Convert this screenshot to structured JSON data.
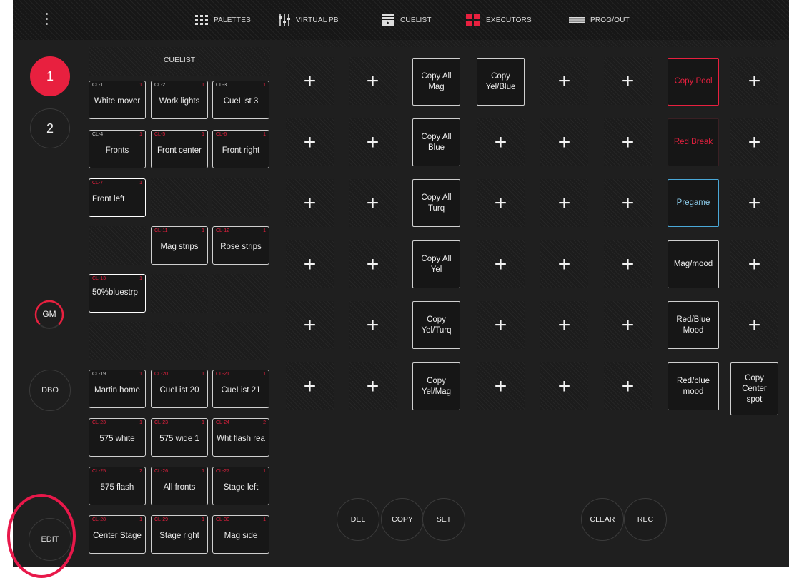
{
  "topbar": {
    "nav": [
      {
        "label": "PALETTES",
        "icon": "grid-icon"
      },
      {
        "label": "VIRTUAL PB",
        "icon": "faders-icon"
      },
      {
        "label": "CUELIST",
        "icon": "cuelist-icon"
      },
      {
        "label": "EXECUTORS",
        "icon": "executors-icon"
      },
      {
        "label": "PROG/OUT",
        "icon": "progout-icon"
      }
    ]
  },
  "left": {
    "page1": "1",
    "page2": "2",
    "gm": "GM",
    "dbo": "DBO",
    "edit": "EDIT"
  },
  "cuelist": {
    "header": "CUELIST",
    "items": [
      {
        "id": "CL-1",
        "num": "1",
        "label": "White mover"
      },
      {
        "id": "CL-2",
        "num": "1",
        "label": "Work lights"
      },
      {
        "id": "CL-3",
        "num": "1",
        "label": "CueList 3"
      },
      {
        "id": "CL-4",
        "num": "1",
        "label": "Fronts"
      },
      {
        "id": "CL-5",
        "num": "1",
        "label": "Front center"
      },
      {
        "id": "CL-6",
        "num": "1",
        "label": "Front right"
      },
      {
        "id": "CL-7",
        "num": "1",
        "label": "Front left"
      },
      {
        "id": "CL-11",
        "num": "1",
        "label": "Mag strips"
      },
      {
        "id": "CL-12",
        "num": "1",
        "label": "Rose strips"
      },
      {
        "id": "CL-13",
        "num": "1",
        "label": "50%bluestrp"
      },
      {
        "id": "CL-19",
        "num": "1",
        "label": "Martin home"
      },
      {
        "id": "CL-20",
        "num": "1",
        "label": "CueList 20"
      },
      {
        "id": "CL-21",
        "num": "1",
        "label": "CueList 21"
      },
      {
        "id": "CL-23",
        "num": "1",
        "label": "575 white"
      },
      {
        "id": "CL-23",
        "num": "1",
        "label": "575 wide 1"
      },
      {
        "id": "CL-24",
        "num": "2",
        "label": "Wht flash rea"
      },
      {
        "id": "CL-25",
        "num": "2",
        "label": "575 flash"
      },
      {
        "id": "CL-26",
        "num": "1",
        "label": "All fronts"
      },
      {
        "id": "CL-27",
        "num": "1",
        "label": "Stage left"
      },
      {
        "id": "CL-28",
        "num": "1",
        "label": "Center Stage"
      },
      {
        "id": "CL-29",
        "num": "1",
        "label": "Stage right"
      },
      {
        "id": "CL-30",
        "num": "1",
        "label": "Mag side"
      }
    ]
  },
  "executors": {
    "plus": "+",
    "copy_all_mag": "Copy All Mag",
    "copy_yel_blue": "Copy Yel/Blue",
    "copy_pool": "Copy Pool",
    "copy_all_blue": "Copy All Blue",
    "red_break": "Red Break",
    "copy_all_turq": "Copy All Turq",
    "pregame": "Pregame",
    "copy_all_yel": "Copy All Yel",
    "mag_mood": "Mag/mood",
    "copy_yel_turq": "Copy Yel/Turq",
    "red_blue_mood": "Red/Blue Mood",
    "copy_yel_mag": "Copy Yel/Mag",
    "red_blue_mood_lc": "Red/blue mood",
    "copy_center_spot": "Copy Center spot"
  },
  "bottom": {
    "del": "DEL",
    "copy": "COPY",
    "set": "SET",
    "clear": "CLEAR",
    "rec": "REC"
  },
  "colors": {
    "accent": "#e8203f",
    "blue": "#4aa8d8",
    "background": "#1f1f1f"
  }
}
